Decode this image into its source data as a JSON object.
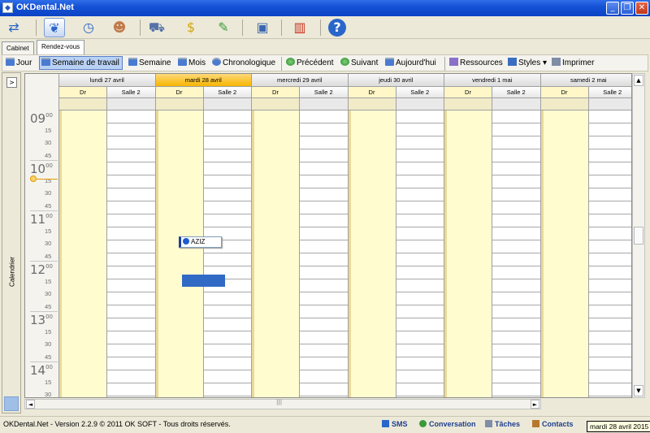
{
  "window": {
    "title": "OKDental.Net",
    "app_icon": "tooth-app-icon"
  },
  "toolbar": {
    "buttons": [
      {
        "name": "transfer-icon",
        "active": false
      },
      {
        "name": "tooth-icon",
        "active": true
      },
      {
        "name": "clock-arrow-icon",
        "active": false
      },
      {
        "name": "patient-icon",
        "active": false
      },
      {
        "name": "cart-icon",
        "active": false
      },
      {
        "name": "money-bag-icon",
        "active": false
      },
      {
        "name": "notes-icon",
        "active": false
      },
      {
        "name": "monitor-icon",
        "active": false
      },
      {
        "name": "bar-chart-icon",
        "active": false
      },
      {
        "name": "help-icon",
        "active": false
      }
    ]
  },
  "tabs": [
    {
      "label": "Cabinet"
    },
    {
      "label": "Rendez-vous",
      "selected": true
    }
  ],
  "viewbar": {
    "jour": "Jour",
    "semaine_travail": "Semaine de travail",
    "semaine": "Semaine",
    "mois": "Mois",
    "chronologique": "Chronologique",
    "precedent": "Précédent",
    "suivant": "Suivant",
    "aujourdhui": "Aujourd'hui",
    "ressources": "Ressources",
    "styles": "Styles",
    "imprimer": "Imprimer"
  },
  "left_panel": {
    "label": "Calendrier",
    "expand": ">"
  },
  "schedule": {
    "days": [
      {
        "label": "lundi 27 avril",
        "today": false
      },
      {
        "label": "mardi 28 avril",
        "today": true
      },
      {
        "label": "mercredi 29 avril",
        "today": false
      },
      {
        "label": "jeudi 30 avril",
        "today": false
      },
      {
        "label": "vendredi 1 mai",
        "today": false
      },
      {
        "label": "samedi 2 mai",
        "today": false
      }
    ],
    "resources": [
      "Dr",
      "Salle 2"
    ],
    "hours": [
      "09",
      "10",
      "11",
      "12",
      "13",
      "14"
    ],
    "minute_suffix": "00",
    "minutes": [
      "15",
      "30",
      "45"
    ],
    "appointment": {
      "label": "AZIZ",
      "day": "mardi 28 avril",
      "resource": "Dr"
    }
  },
  "scroll": {
    "up": "▲",
    "down": "▼",
    "left": "◄",
    "right": "►",
    "grip": "|||"
  },
  "status": {
    "version": "OKDental.Net - Version 2.2.9 © 2011 OK SOFT - Tous droits réservés.",
    "sms": "SMS",
    "conversation": "Conversation",
    "taches": "Tâches",
    "contacts": "Contacts",
    "tooltip": "mardi 28 avril 2015"
  },
  "colors": {
    "today_header": "#f7b500",
    "selection": "#316ac5",
    "dr_column": "#fffcd0"
  }
}
